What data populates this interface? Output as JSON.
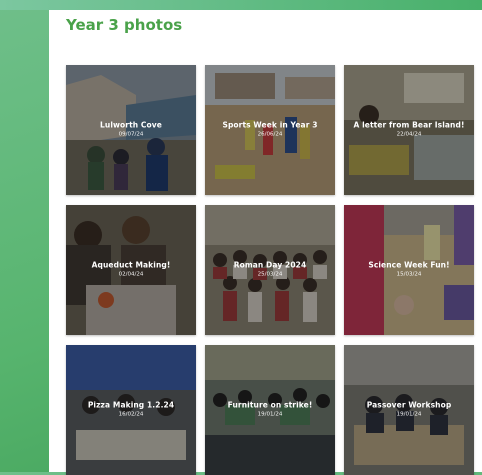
{
  "page": {
    "title": "Year 3 photos"
  },
  "photos": [
    {
      "title": "Lulworth Cove",
      "date": "09/07/24"
    },
    {
      "title": "Sports Week in Year 3",
      "date": "26/06/24"
    },
    {
      "title": "A letter from Bear Island!",
      "date": "22/04/24"
    },
    {
      "title": "Aqueduct Making!",
      "date": "02/04/24"
    },
    {
      "title": "Roman Day 2024",
      "date": "25/03/24"
    },
    {
      "title": "Science Week Fun!",
      "date": "15/03/24"
    },
    {
      "title": "Pizza Making 1.2.24",
      "date": "16/02/24"
    },
    {
      "title": "Furniture on strike!",
      "date": "19/01/24"
    },
    {
      "title": "Passover Workshop",
      "date": "19/01/24"
    }
  ]
}
